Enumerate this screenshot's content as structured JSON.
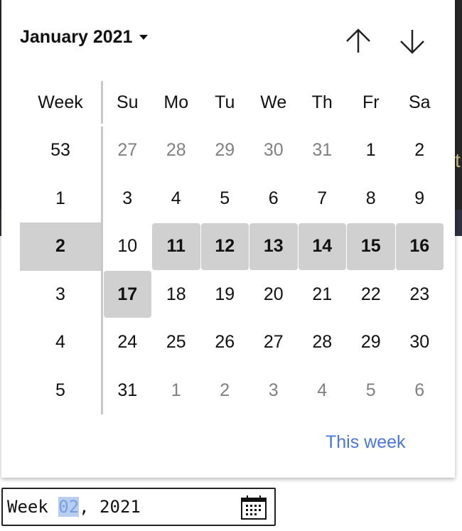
{
  "picker": {
    "month_label": "January 2021",
    "prev_icon": "arrow-up-icon",
    "next_icon": "arrow-down-icon",
    "week_header": "Week",
    "day_headers": [
      "Su",
      "Mo",
      "Tu",
      "We",
      "Th",
      "Fr",
      "Sa"
    ],
    "rows": [
      {
        "week": "53",
        "days": [
          {
            "d": "27",
            "dim": true
          },
          {
            "d": "28",
            "dim": true
          },
          {
            "d": "29",
            "dim": true
          },
          {
            "d": "30",
            "dim": true
          },
          {
            "d": "31",
            "dim": true
          },
          {
            "d": "1"
          },
          {
            "d": "2"
          }
        ]
      },
      {
        "week": "1",
        "days": [
          {
            "d": "3"
          },
          {
            "d": "4"
          },
          {
            "d": "5"
          },
          {
            "d": "6"
          },
          {
            "d": "7"
          },
          {
            "d": "8"
          },
          {
            "d": "9"
          }
        ]
      },
      {
        "week": "2",
        "selected": true,
        "days": [
          {
            "d": "10"
          },
          {
            "d": "11",
            "sel": true
          },
          {
            "d": "12",
            "sel": true
          },
          {
            "d": "13",
            "sel": true
          },
          {
            "d": "14",
            "sel": true
          },
          {
            "d": "15",
            "sel": true
          },
          {
            "d": "16",
            "sel": true
          }
        ]
      },
      {
        "week": "3",
        "days": [
          {
            "d": "17",
            "sel": true
          },
          {
            "d": "18"
          },
          {
            "d": "19"
          },
          {
            "d": "20"
          },
          {
            "d": "21"
          },
          {
            "d": "22"
          },
          {
            "d": "23"
          }
        ]
      },
      {
        "week": "4",
        "days": [
          {
            "d": "24"
          },
          {
            "d": "25"
          },
          {
            "d": "26"
          },
          {
            "d": "27"
          },
          {
            "d": "28"
          },
          {
            "d": "29"
          },
          {
            "d": "30"
          }
        ]
      },
      {
        "week": "5",
        "days": [
          {
            "d": "31"
          },
          {
            "d": "1",
            "dim": true
          },
          {
            "d": "2",
            "dim": true
          },
          {
            "d": "3",
            "dim": true
          },
          {
            "d": "4",
            "dim": true
          },
          {
            "d": "5",
            "dim": true
          },
          {
            "d": "6",
            "dim": true
          }
        ]
      }
    ],
    "this_week_label": "This week"
  },
  "input": {
    "prefix": "Week ",
    "week_value": "02",
    "suffix": ", 2021",
    "icon": "calendar-icon"
  },
  "colors": {
    "accent": "#4a78d8",
    "selected_bg": "#d0d0d0",
    "dim_text": "#808080"
  }
}
